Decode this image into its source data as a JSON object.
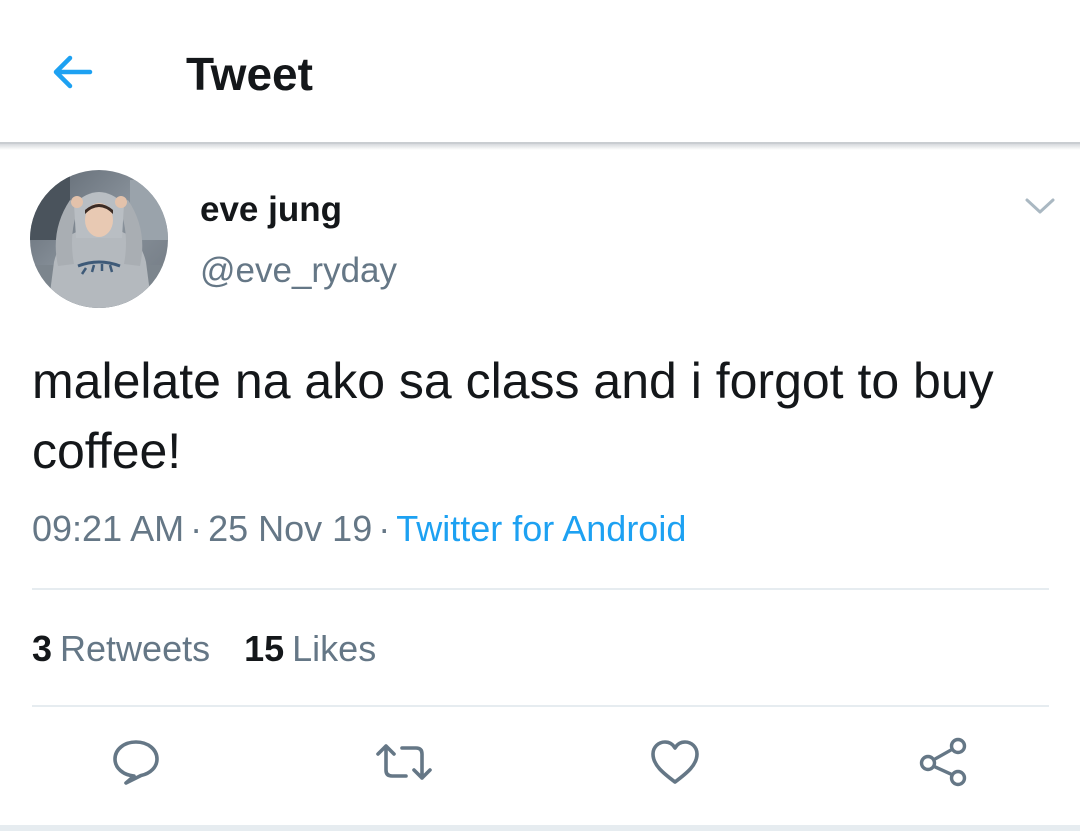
{
  "header": {
    "title": "Tweet",
    "back_icon": "arrow-left-icon"
  },
  "tweet": {
    "author": {
      "display_name": "eve jung",
      "handle": "@eve_ryday"
    },
    "text": "malelate na ako sa class and i forgot to buy coffee!",
    "time": "09:21 AM",
    "date": "25 Nov 19",
    "separator": "·",
    "source": "Twitter for Android",
    "stats": {
      "retweets_count": "3",
      "retweets_label": "Retweets",
      "likes_count": "15",
      "likes_label": "Likes"
    }
  },
  "actions": [
    "reply-icon",
    "retweet-icon",
    "like-icon",
    "share-icon"
  ],
  "colors": {
    "accent": "#1da1f2",
    "text_primary": "#14171a",
    "text_secondary": "#657786",
    "icon": "#657786",
    "divider": "#e6ecf0"
  }
}
